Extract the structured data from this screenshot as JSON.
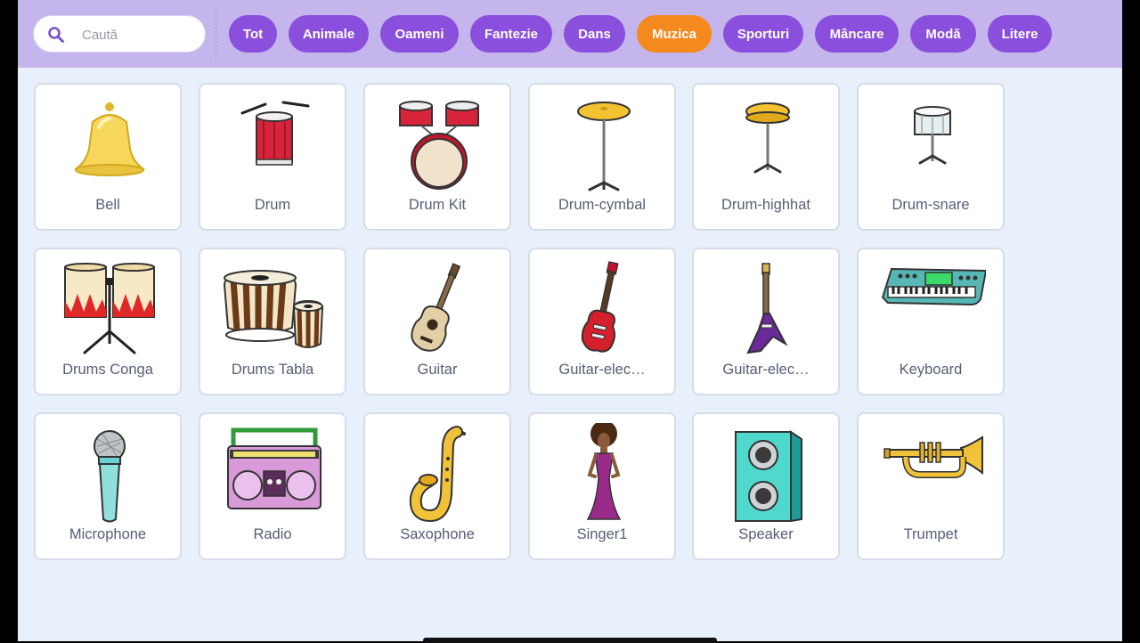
{
  "search": {
    "placeholder": "Caută",
    "icon": "search-icon"
  },
  "categories": [
    {
      "label": "Tot",
      "active": false
    },
    {
      "label": "Animale",
      "active": false
    },
    {
      "label": "Oameni",
      "active": false
    },
    {
      "label": "Fantezie",
      "active": false
    },
    {
      "label": "Dans",
      "active": false
    },
    {
      "label": "Muzica",
      "active": true
    },
    {
      "label": "Sporturi",
      "active": false
    },
    {
      "label": "Mâncare",
      "active": false
    },
    {
      "label": "Modă",
      "active": false
    },
    {
      "label": "Litere",
      "active": false
    }
  ],
  "sprites": [
    {
      "label": "Bell",
      "icon": "bell-icon"
    },
    {
      "label": "Drum",
      "icon": "drum-icon"
    },
    {
      "label": "Drum Kit",
      "icon": "drum-kit-icon"
    },
    {
      "label": "Drum-cymbal",
      "icon": "cymbal-icon"
    },
    {
      "label": "Drum-highhat",
      "icon": "hihat-icon"
    },
    {
      "label": "Drum-snare",
      "icon": "snare-drum-icon"
    },
    {
      "label": "Drums Conga",
      "icon": "conga-drums-icon"
    },
    {
      "label": "Drums Tabla",
      "icon": "tabla-drums-icon"
    },
    {
      "label": "Guitar",
      "icon": "acoustic-guitar-icon"
    },
    {
      "label": "Guitar-elec…",
      "icon": "electric-guitar-red-icon"
    },
    {
      "label": "Guitar-elec…",
      "icon": "electric-guitar-purple-icon"
    },
    {
      "label": "Keyboard",
      "icon": "keyboard-synth-icon"
    },
    {
      "label": "Microphone",
      "icon": "microphone-icon"
    },
    {
      "label": "Radio",
      "icon": "boombox-radio-icon"
    },
    {
      "label": "Saxophone",
      "icon": "saxophone-icon"
    },
    {
      "label": "Singer1",
      "icon": "singer-icon"
    },
    {
      "label": "Speaker",
      "icon": "speaker-icon"
    },
    {
      "label": "Trumpet",
      "icon": "trumpet-icon"
    }
  ],
  "colors": {
    "topbar": "#c4b5ec",
    "category": "#8a4fdc",
    "category_active": "#f48a1e",
    "background": "#e8f0fb"
  }
}
